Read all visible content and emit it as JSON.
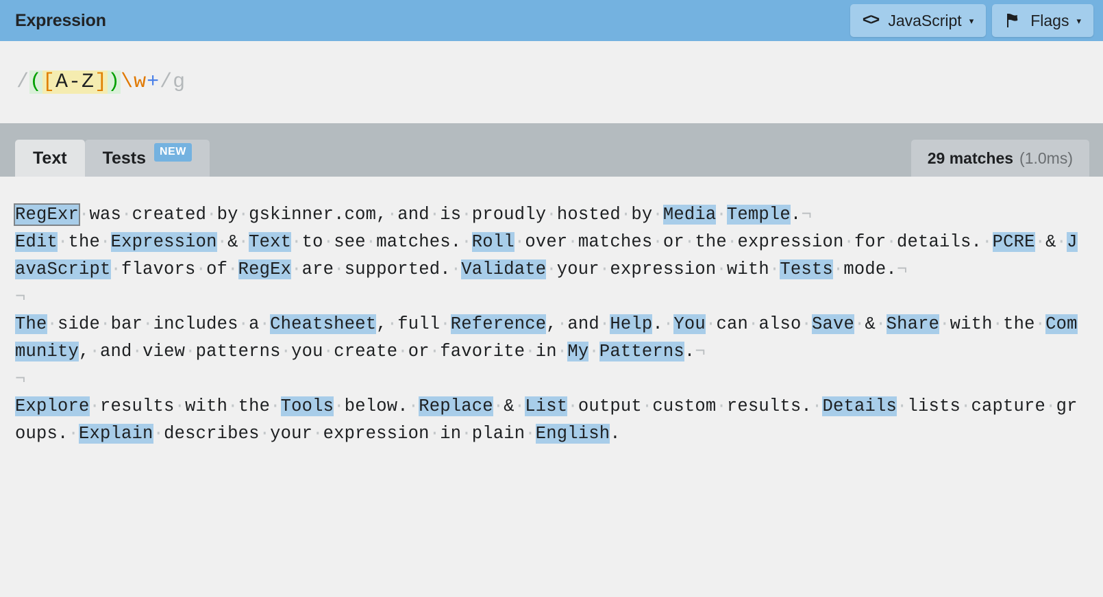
{
  "header": {
    "title": "Expression",
    "flavor_button": {
      "label": "JavaScript",
      "icon": "code-icon",
      "caret": "▾"
    },
    "flags_button": {
      "label": "Flags",
      "icon": "flag-icon",
      "caret": "▾"
    },
    "background_color": "#74b2e0",
    "button_color": "#a3cdec"
  },
  "expression": {
    "full": "/([A-Z])\\w+/g",
    "tokens": [
      {
        "text": "/",
        "type": "delimiter"
      },
      {
        "text": "(",
        "type": "group"
      },
      {
        "text": "[",
        "type": "set"
      },
      {
        "text": "A-Z",
        "type": "set-chars"
      },
      {
        "text": "]",
        "type": "set"
      },
      {
        "text": ")",
        "type": "group"
      },
      {
        "text": "\\w",
        "type": "escape"
      },
      {
        "text": "+",
        "type": "quantifier"
      },
      {
        "text": "/",
        "type": "delimiter"
      },
      {
        "text": "g",
        "type": "flags"
      }
    ],
    "colors": {
      "delimiter": "#b4b8ba",
      "group": "#00a000",
      "group_bg": "#daf0d9",
      "set": "#e08000",
      "set_bg": "#f5ecb0",
      "escape": "#e07800",
      "quantifier": "#4a80e8",
      "flags": "#b4b8ba"
    }
  },
  "tabs": [
    {
      "label": "Text",
      "active": true,
      "badge": null
    },
    {
      "label": "Tests",
      "active": false,
      "badge": "NEW"
    }
  ],
  "match_info": {
    "count_label": "29 matches",
    "time_label": "(1.0ms)"
  },
  "document": {
    "space_dot": "·",
    "newline_mark": "¬",
    "paragraphs": [
      {
        "segments": [
          {
            "t": "RegExr",
            "h": "hover"
          },
          {
            "t": " "
          },
          {
            "t": "was"
          },
          {
            "t": " "
          },
          {
            "t": "created"
          },
          {
            "t": " "
          },
          {
            "t": "by"
          },
          {
            "t": " "
          },
          {
            "t": "gskinner.com,"
          },
          {
            "t": " "
          },
          {
            "t": "and"
          },
          {
            "t": " "
          },
          {
            "t": "is"
          },
          {
            "t": " "
          },
          {
            "t": "proudly"
          },
          {
            "t": " "
          },
          {
            "t": "hosted"
          },
          {
            "t": " "
          },
          {
            "t": "by"
          },
          {
            "t": " "
          },
          {
            "t": "Media",
            "h": "match"
          },
          {
            "t": " "
          },
          {
            "t": "Temple",
            "h": "match"
          },
          {
            "t": "."
          },
          {
            "t": "\n"
          }
        ]
      },
      {
        "segments": [
          {
            "t": "Edit",
            "h": "match"
          },
          {
            "t": " "
          },
          {
            "t": "the"
          },
          {
            "t": " "
          },
          {
            "t": "Expression",
            "h": "match"
          },
          {
            "t": " "
          },
          {
            "t": "&"
          },
          {
            "t": " "
          },
          {
            "t": "Text",
            "h": "match"
          },
          {
            "t": " "
          },
          {
            "t": "to"
          },
          {
            "t": " "
          },
          {
            "t": "see"
          },
          {
            "t": " "
          },
          {
            "t": "matches."
          },
          {
            "t": " "
          },
          {
            "t": "Roll",
            "h": "match"
          },
          {
            "t": " "
          },
          {
            "t": "over"
          },
          {
            "t": " "
          },
          {
            "t": "matches"
          },
          {
            "t": " "
          },
          {
            "t": "or"
          },
          {
            "t": " "
          },
          {
            "t": "the"
          },
          {
            "t": " "
          },
          {
            "t": "expression"
          },
          {
            "t": " "
          },
          {
            "t": "for"
          },
          {
            "t": " "
          },
          {
            "t": "details."
          },
          {
            "t": " "
          },
          {
            "t": "PCRE",
            "h": "match"
          },
          {
            "t": " "
          },
          {
            "t": "&"
          },
          {
            "t": " "
          },
          {
            "t": "JavaScript",
            "h": "match"
          },
          {
            "t": " "
          },
          {
            "t": "flavors"
          },
          {
            "t": " "
          },
          {
            "t": "of"
          },
          {
            "t": " "
          },
          {
            "t": "RegEx",
            "h": "match"
          },
          {
            "t": " "
          },
          {
            "t": "are"
          },
          {
            "t": " "
          },
          {
            "t": "supported."
          },
          {
            "t": " "
          },
          {
            "t": "Validate",
            "h": "match"
          },
          {
            "t": " "
          },
          {
            "t": "your"
          },
          {
            "t": " "
          },
          {
            "t": "expression"
          },
          {
            "t": " "
          },
          {
            "t": "with"
          },
          {
            "t": " "
          },
          {
            "t": "Tests",
            "h": "match"
          },
          {
            "t": " "
          },
          {
            "t": "mode."
          },
          {
            "t": "\n"
          }
        ]
      },
      {
        "blank": true,
        "segments": [
          {
            "t": "\n"
          }
        ]
      },
      {
        "segments": [
          {
            "t": "The",
            "h": "match"
          },
          {
            "t": " "
          },
          {
            "t": "side"
          },
          {
            "t": " "
          },
          {
            "t": "bar"
          },
          {
            "t": " "
          },
          {
            "t": "includes"
          },
          {
            "t": " "
          },
          {
            "t": "a"
          },
          {
            "t": " "
          },
          {
            "t": "Cheatsheet",
            "h": "match"
          },
          {
            "t": ","
          },
          {
            "t": " "
          },
          {
            "t": "full"
          },
          {
            "t": " "
          },
          {
            "t": "Reference",
            "h": "match"
          },
          {
            "t": ","
          },
          {
            "t": " "
          },
          {
            "t": "and"
          },
          {
            "t": " "
          },
          {
            "t": "Help",
            "h": "match"
          },
          {
            "t": "."
          },
          {
            "t": " "
          },
          {
            "t": "You",
            "h": "match"
          },
          {
            "t": " "
          },
          {
            "t": "can"
          },
          {
            "t": " "
          },
          {
            "t": "also"
          },
          {
            "t": " "
          },
          {
            "t": "Save",
            "h": "match"
          },
          {
            "t": " "
          },
          {
            "t": "&"
          },
          {
            "t": " "
          },
          {
            "t": "Share",
            "h": "match"
          },
          {
            "t": " "
          },
          {
            "t": "with"
          },
          {
            "t": " "
          },
          {
            "t": "the"
          },
          {
            "t": " "
          },
          {
            "t": "Community",
            "h": "match"
          },
          {
            "t": ","
          },
          {
            "t": " "
          },
          {
            "t": "and"
          },
          {
            "t": " "
          },
          {
            "t": "view"
          },
          {
            "t": " "
          },
          {
            "t": "patterns"
          },
          {
            "t": " "
          },
          {
            "t": "you"
          },
          {
            "t": " "
          },
          {
            "t": "create"
          },
          {
            "t": " "
          },
          {
            "t": "or"
          },
          {
            "t": " "
          },
          {
            "t": "favorite"
          },
          {
            "t": " "
          },
          {
            "t": "in"
          },
          {
            "t": " "
          },
          {
            "t": "My",
            "h": "match"
          },
          {
            "t": " "
          },
          {
            "t": "Patterns",
            "h": "match"
          },
          {
            "t": "."
          },
          {
            "t": "\n"
          }
        ]
      },
      {
        "blank": true,
        "segments": [
          {
            "t": "\n"
          }
        ]
      },
      {
        "segments": [
          {
            "t": "Explore",
            "h": "match"
          },
          {
            "t": " "
          },
          {
            "t": "results"
          },
          {
            "t": " "
          },
          {
            "t": "with"
          },
          {
            "t": " "
          },
          {
            "t": "the"
          },
          {
            "t": " "
          },
          {
            "t": "Tools",
            "h": "match"
          },
          {
            "t": " "
          },
          {
            "t": "below."
          },
          {
            "t": " "
          },
          {
            "t": "Replace",
            "h": "match"
          },
          {
            "t": " "
          },
          {
            "t": "&"
          },
          {
            "t": " "
          },
          {
            "t": "List",
            "h": "match"
          },
          {
            "t": " "
          },
          {
            "t": "output"
          },
          {
            "t": " "
          },
          {
            "t": "custom"
          },
          {
            "t": " "
          },
          {
            "t": "results."
          },
          {
            "t": " "
          },
          {
            "t": "Details",
            "h": "match"
          },
          {
            "t": " "
          },
          {
            "t": "lists"
          },
          {
            "t": " "
          },
          {
            "t": "capture"
          },
          {
            "t": " "
          },
          {
            "t": "groups."
          },
          {
            "t": " "
          },
          {
            "t": "Explain",
            "h": "match"
          },
          {
            "t": " "
          },
          {
            "t": "describes"
          },
          {
            "t": " "
          },
          {
            "t": "your"
          },
          {
            "t": " "
          },
          {
            "t": "expression"
          },
          {
            "t": " "
          },
          {
            "t": "in"
          },
          {
            "t": " "
          },
          {
            "t": "plain"
          },
          {
            "t": " "
          },
          {
            "t": "English",
            "h": "match"
          },
          {
            "t": "."
          }
        ]
      }
    ]
  }
}
